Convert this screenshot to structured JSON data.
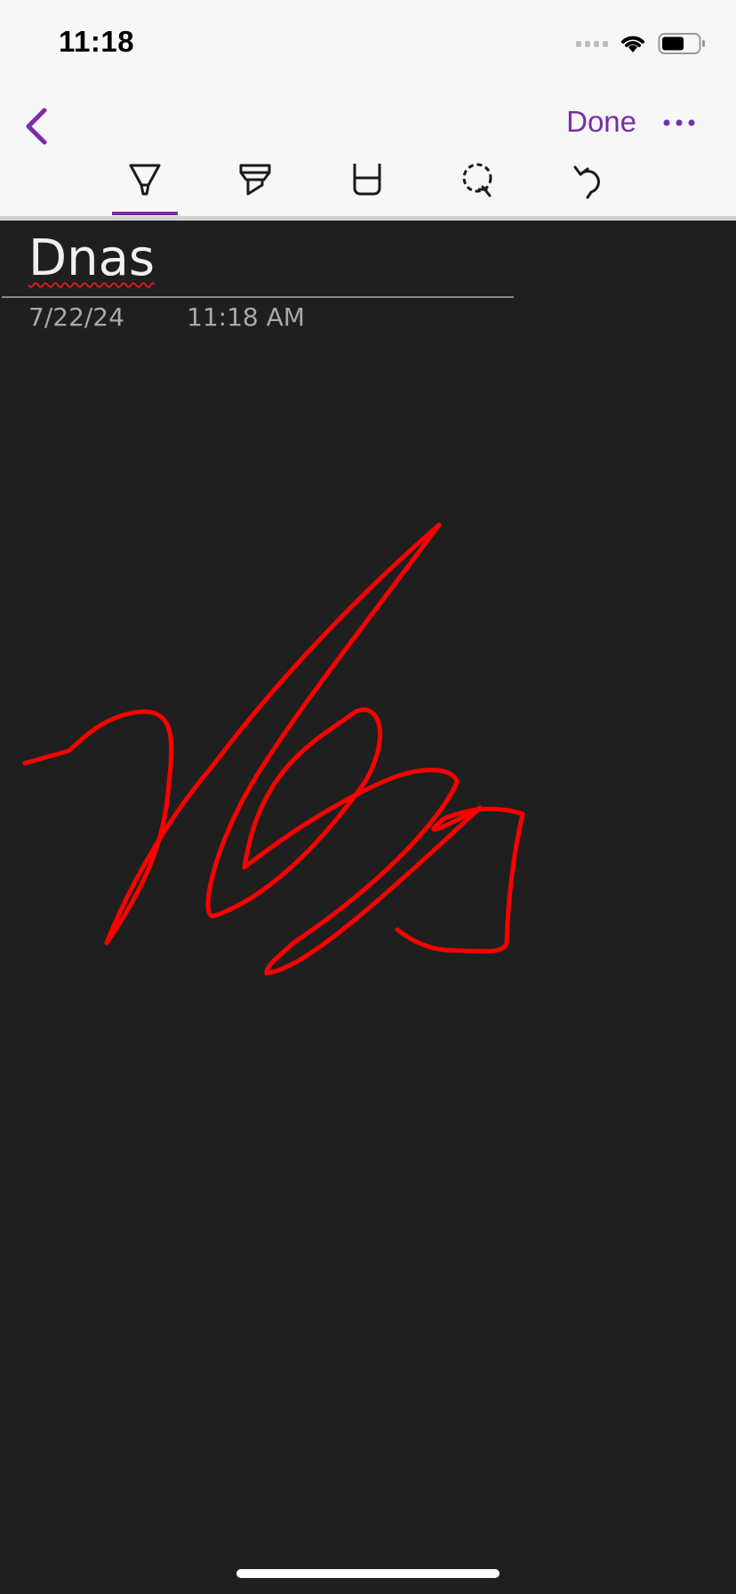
{
  "status_bar": {
    "time": "11:18"
  },
  "nav": {
    "done_label": "Done",
    "back_icon": "chevron-left-icon",
    "more_icon": "ellipsis-icon"
  },
  "toolbar": {
    "tools": [
      {
        "name": "pen",
        "icon": "pen-icon",
        "active": true
      },
      {
        "name": "highlighter",
        "icon": "highlighter-icon",
        "active": false
      },
      {
        "name": "eraser",
        "icon": "eraser-icon",
        "active": false
      },
      {
        "name": "lasso",
        "icon": "lasso-select-icon",
        "active": false
      },
      {
        "name": "undo",
        "icon": "undo-icon",
        "active": false
      }
    ]
  },
  "page": {
    "title": "Dnas",
    "date": "7/22/24",
    "time": "11:18 AM"
  },
  "colors": {
    "accent": "#7b2ca8",
    "ink": "#ff0000",
    "canvas": "#1f1f1f",
    "toolbar_bg": "#f7f7f7"
  }
}
